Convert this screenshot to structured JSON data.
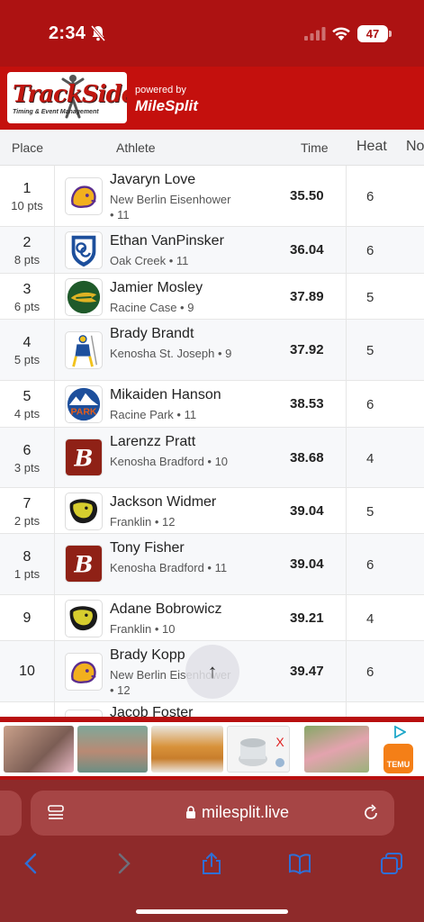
{
  "status": {
    "time": "2:34",
    "battery": "47"
  },
  "brand": {
    "logo_title": "TrackSide",
    "logo_sub": "Timing & Event Management",
    "powered_by": "powered by",
    "milesplit": "MileSplit"
  },
  "table": {
    "headers": {
      "place": "Place",
      "athlete": "Athlete",
      "time": "Time",
      "heat": "Heat",
      "extra": "No"
    },
    "rows": [
      {
        "place": "1",
        "pts": "10 pts",
        "name": "Javaryn Love",
        "school": "New Berlin Eisenhower • 11",
        "time": "35.50",
        "heat": "6",
        "logo": "lion-icon"
      },
      {
        "place": "2",
        "pts": "8 pts",
        "name": "Ethan VanPinsker",
        "school": "Oak Creek • 11",
        "time": "36.04",
        "heat": "6",
        "logo": "oc-shield-icon"
      },
      {
        "place": "3",
        "pts": "6 pts",
        "name": "Jamier Mosley",
        "school": "Racine Case • 9",
        "time": "37.89",
        "heat": "5",
        "logo": "eagle-icon"
      },
      {
        "place": "4",
        "pts": "5 pts",
        "name": "Brady Brandt",
        "school": "Kenosha St. Joseph • 9",
        "time": "37.92",
        "heat": "5",
        "logo": "lancer-icon"
      },
      {
        "place": "5",
        "pts": "4 pts",
        "name": "Mikaiden Hanson",
        "school": "Racine Park • 11",
        "time": "38.53",
        "heat": "6",
        "logo": "park-icon"
      },
      {
        "place": "6",
        "pts": "3 pts",
        "name": "Larenzz Pratt",
        "school": "Kenosha Bradford • 10",
        "time": "38.68",
        "heat": "4",
        "logo": "b-icon"
      },
      {
        "place": "7",
        "pts": "2 pts",
        "name": "Jackson Widmer",
        "school": "Franklin • 12",
        "time": "39.04",
        "heat": "5",
        "logo": "sabre-icon"
      },
      {
        "place": "8",
        "pts": "1 pts",
        "name": "Tony Fisher",
        "school": "Kenosha Bradford • 11",
        "time": "39.04",
        "heat": "6",
        "logo": "b-icon"
      },
      {
        "place": "9",
        "pts": "",
        "name": "Adane Bobrowicz",
        "school": "Franklin • 10",
        "time": "39.21",
        "heat": "4",
        "logo": "sabre-icon"
      },
      {
        "place": "10",
        "pts": "",
        "name": "Brady Kopp",
        "school": "New Berlin Eisenhower • 12",
        "time": "39.47",
        "heat": "6",
        "logo": "lion-icon"
      },
      {
        "place": "",
        "pts": "",
        "name": "Jacob Foster",
        "school": "",
        "time": "",
        "heat": "",
        "logo": ""
      }
    ]
  },
  "ad": {
    "brand": "TEMU"
  },
  "browser": {
    "url": "milesplit.live"
  },
  "colors": {
    "brand_red": "#c4100d",
    "status_red": "#ad1212",
    "chrome": "#8e2a2a",
    "link_blue": "#2f6fd6"
  }
}
